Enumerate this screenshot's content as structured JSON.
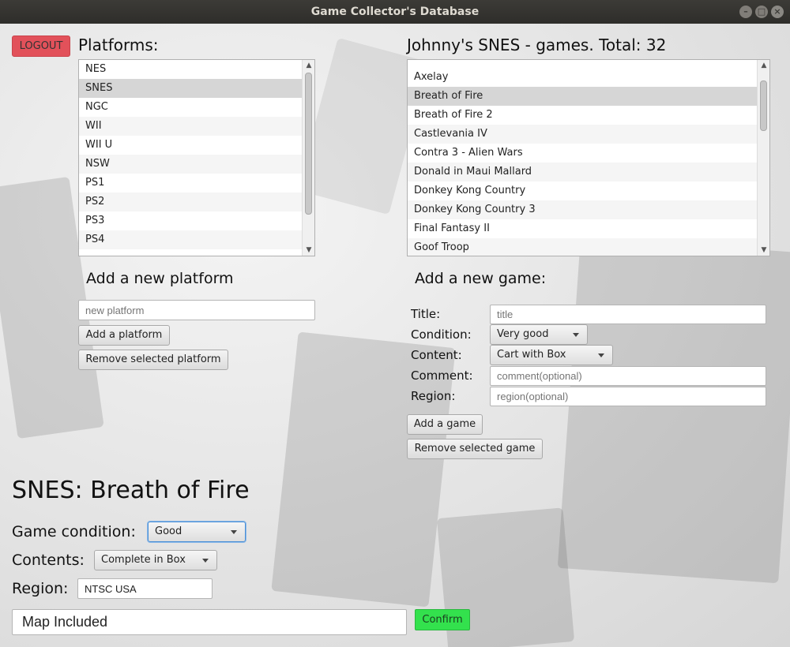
{
  "window": {
    "title": "Game Collector's Database"
  },
  "logout_label": "LOGOUT",
  "platforms": {
    "heading": "Platforms:",
    "items": [
      "NES",
      "SNES",
      "NGC",
      "WII",
      "WII U",
      "NSW",
      "PS1",
      "PS2",
      "PS3",
      "PS4"
    ],
    "selected": "SNES",
    "add_heading": "Add a new platform",
    "new_placeholder": "new platform",
    "add_button": "Add a platform",
    "remove_button": "Remove selected platform"
  },
  "games": {
    "heading": "Johnny's SNES - games. Total: 32",
    "items": [
      "Axelay",
      "Breath of Fire",
      "Breath of Fire 2",
      "Castlevania IV",
      "Contra 3 - Alien Wars",
      "Donald in Maui Mallard",
      "Donkey Kong Country",
      "Donkey Kong Country 3",
      "Final Fantasy II",
      "Goof Troop"
    ],
    "selected": "Breath of Fire",
    "add_heading": "Add a new game:",
    "form": {
      "title_label": "Title:",
      "title_placeholder": "title",
      "condition_label": "Condition:",
      "condition_value": "Very good",
      "content_label": "Content:",
      "content_value": "Cart with Box",
      "comment_label": "Comment:",
      "comment_placeholder": "comment(optional)",
      "region_label": "Region:",
      "region_placeholder": "region(optional)"
    },
    "add_button": "Add a game",
    "remove_button": "Remove selected game"
  },
  "detail": {
    "title": "SNES: Breath of Fire",
    "condition_label": "Game condition:",
    "condition_value": "Good",
    "contents_label": "Contents:",
    "contents_value": "Complete in Box",
    "region_label": "Region:",
    "region_value": "NTSC USA",
    "comment_value": "Map Included",
    "confirm_label": "Confirm"
  }
}
